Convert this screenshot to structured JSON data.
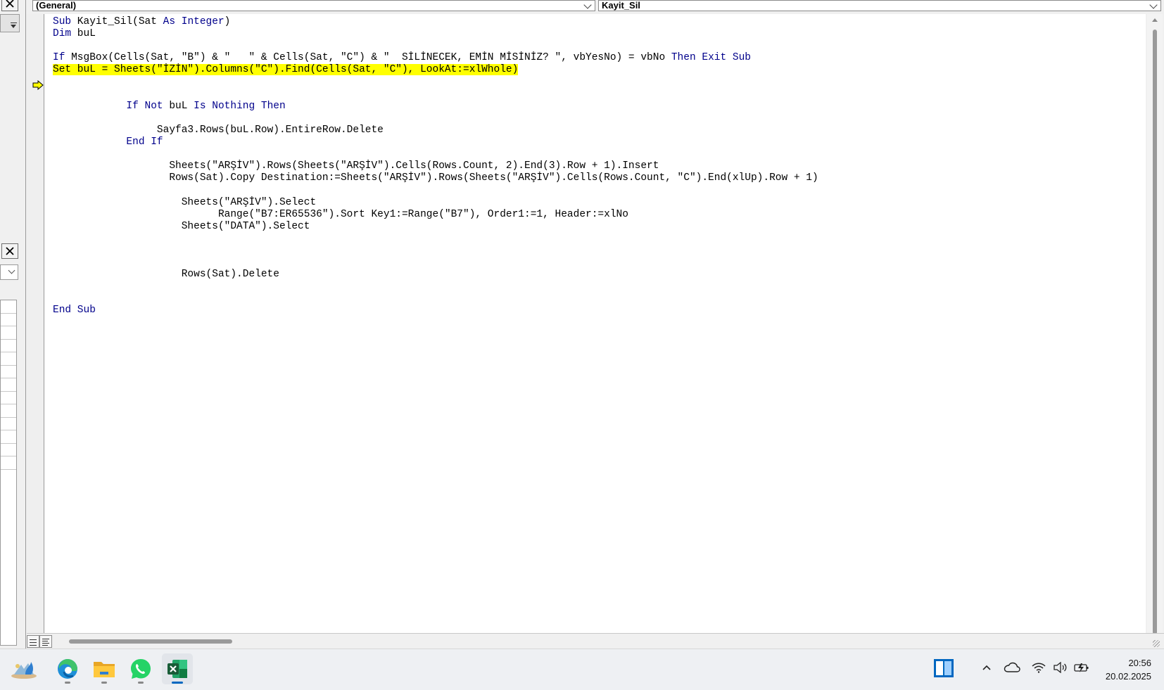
{
  "code_window": {
    "object_combo": "(General)",
    "procedure_combo": "Kayit_Sil"
  },
  "code": {
    "lines": [
      [
        {
          "t": "Sub",
          "k": 1
        },
        {
          "t": " Kayit_Sil(Sat "
        },
        {
          "t": "As",
          "k": 1
        },
        {
          "t": " "
        },
        {
          "t": "Integer",
          "k": 1
        },
        {
          "t": ")"
        }
      ],
      [
        {
          "t": "Dim",
          "k": 1
        },
        {
          "t": " buL"
        }
      ],
      [],
      [
        {
          "t": "If",
          "k": 1
        },
        {
          "t": " MsgBox(Cells(Sat, \"B\") & \"   \" & Cells(Sat, \"C\") & \"  SİLİNECEK, EMİN MİSİNİZ? \", vbYesNo) = vbNo "
        },
        {
          "t": "Then",
          "k": 1
        },
        {
          "t": " "
        },
        {
          "t": "Exit",
          "k": 1
        },
        {
          "t": " "
        },
        {
          "t": "Sub",
          "k": 1
        }
      ],
      [
        {
          "t": "Set buL = Sheets(\"İZİN\").Columns(\"C\").Find(Cells(Sat, \"C\"), LookAt:=xlWhole)",
          "hl": 1
        }
      ],
      [],
      [],
      [
        {
          "t": "            "
        },
        {
          "t": "If Not",
          "k": 1
        },
        {
          "t": " buL "
        },
        {
          "t": "Is Nothing Then",
          "k": 1
        }
      ],
      [],
      [
        {
          "t": "                 Sayfa3.Rows(buL.Row).EntireRow.Delete"
        }
      ],
      [
        {
          "t": "            "
        },
        {
          "t": "End If",
          "k": 1
        }
      ],
      [],
      [
        {
          "t": "                   Sheets(\"ARŞİV\").Rows(Sheets(\"ARŞİV\").Cells(Rows.Count, 2).End(3).Row + 1).Insert"
        }
      ],
      [
        {
          "t": "                   Rows(Sat).Copy Destination:=Sheets(\"ARŞİV\").Rows(Sheets(\"ARŞİV\").Cells(Rows.Count, \"C\").End(xlUp).Row + 1)"
        }
      ],
      [],
      [
        {
          "t": "                     Sheets(\"ARŞİV\").Select"
        }
      ],
      [
        {
          "t": "                           Range(\"B7:ER65536\").Sort Key1:=Range(\"B7\"), Order1:=1, Header:=xlNo"
        }
      ],
      [
        {
          "t": "                     Sheets(\"DATA\").Select"
        }
      ],
      [],
      [],
      [],
      [
        {
          "t": "                     Rows(Sat).Delete"
        }
      ],
      [],
      [],
      [
        {
          "t": "End Sub",
          "k": 1
        }
      ]
    ],
    "keyword_color": "#00008b",
    "highlight_color": "#ffff00"
  },
  "icons": {
    "pane_close": "close-icon",
    "execution_point": "execution-arrow-icon",
    "taskbar": [
      "widgets-icon",
      "edge-icon",
      "file-explorer-icon",
      "whatsapp-icon",
      "excel-icon"
    ],
    "tray": [
      "snap-layout-icon",
      "chevron-up-icon",
      "onedrive-icon",
      "wifi-icon",
      "volume-icon",
      "battery-icon"
    ]
  },
  "taskbar": {
    "time": "20:56",
    "date": "20.02.2025"
  }
}
